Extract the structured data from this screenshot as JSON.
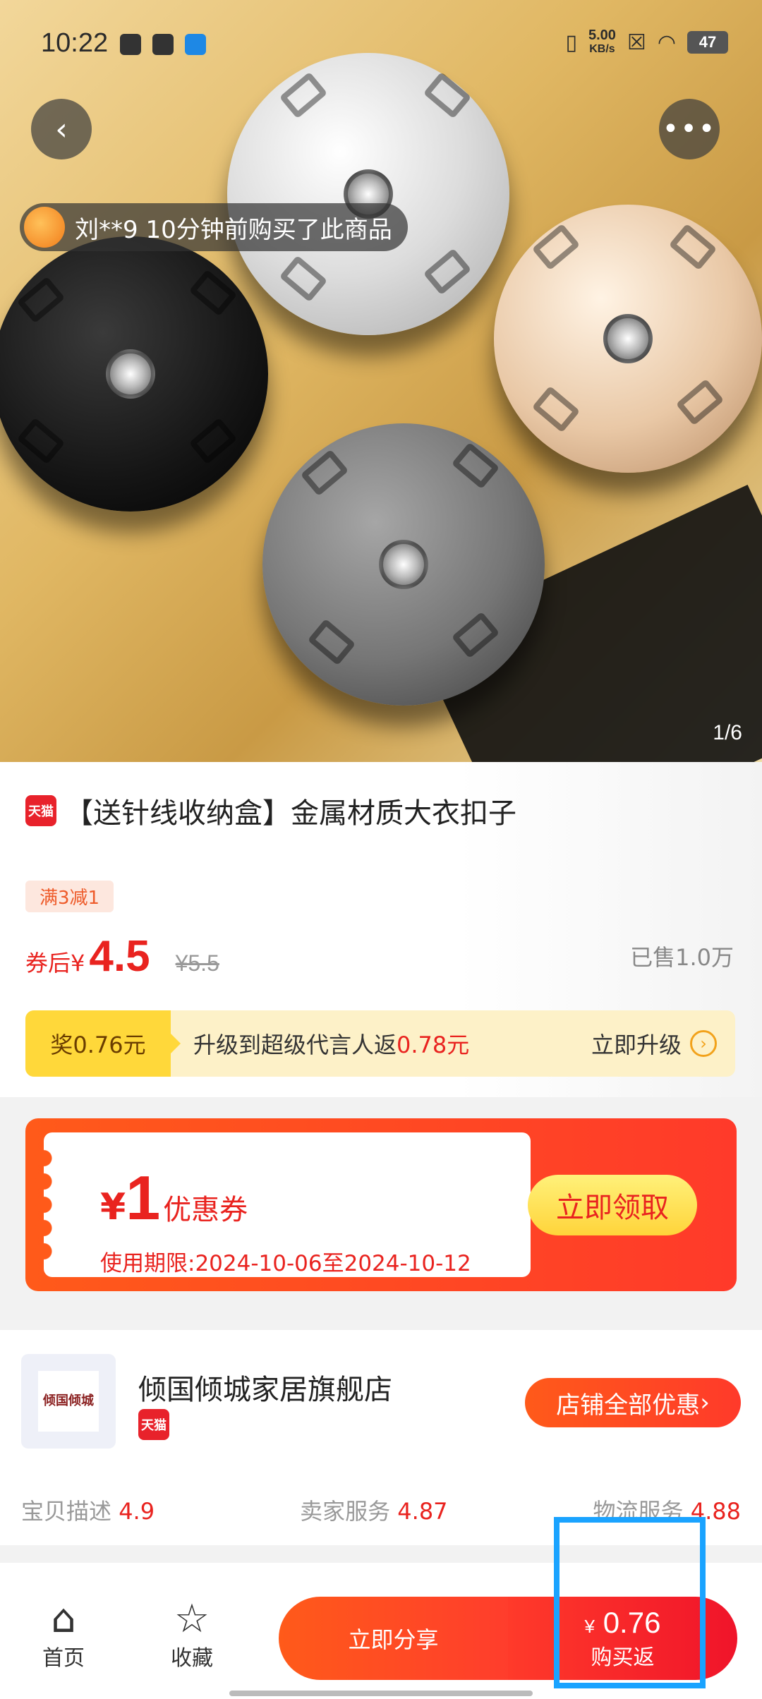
{
  "status_bar": {
    "time": "10:22",
    "net_speed_value": "5.00",
    "net_speed_unit": "KB/s",
    "battery": "47"
  },
  "gallery": {
    "buyer_notice": "刘**9  10分钟前购买了此商品",
    "counter": "1/6"
  },
  "product": {
    "platform_badge": "天猫",
    "title": "【送针线收纳盒】金属材质大衣扣子",
    "promo_tag": "满3减1",
    "price_prefix": "券后¥",
    "price": "4.5",
    "original_price": "¥5.5",
    "sold": "已售1.0万"
  },
  "reward": {
    "badge": "奖0.76元",
    "text_before": "升级到超级代言人返",
    "text_highlight": "0.78元",
    "action": "立即升级"
  },
  "coupon": {
    "currency": "¥",
    "amount": "1",
    "label": "优惠券",
    "validity": "使用期限:2024-10-06至2024-10-12",
    "button": "立即领取"
  },
  "shop": {
    "logo_text": "倾国倾城",
    "name": "倾国倾城家居旗舰店",
    "badge": "天猫",
    "button": "店铺全部优惠",
    "scores": [
      {
        "label": "宝贝描述",
        "value": "4.9"
      },
      {
        "label": "卖家服务",
        "value": "4.87"
      },
      {
        "label": "物流服务",
        "value": "4.88"
      }
    ]
  },
  "bottom_bar": {
    "home": "首页",
    "favorite": "收藏",
    "share": "立即分享",
    "buy_currency": "¥",
    "buy_price": "0.76",
    "buy_label": "购买返"
  }
}
